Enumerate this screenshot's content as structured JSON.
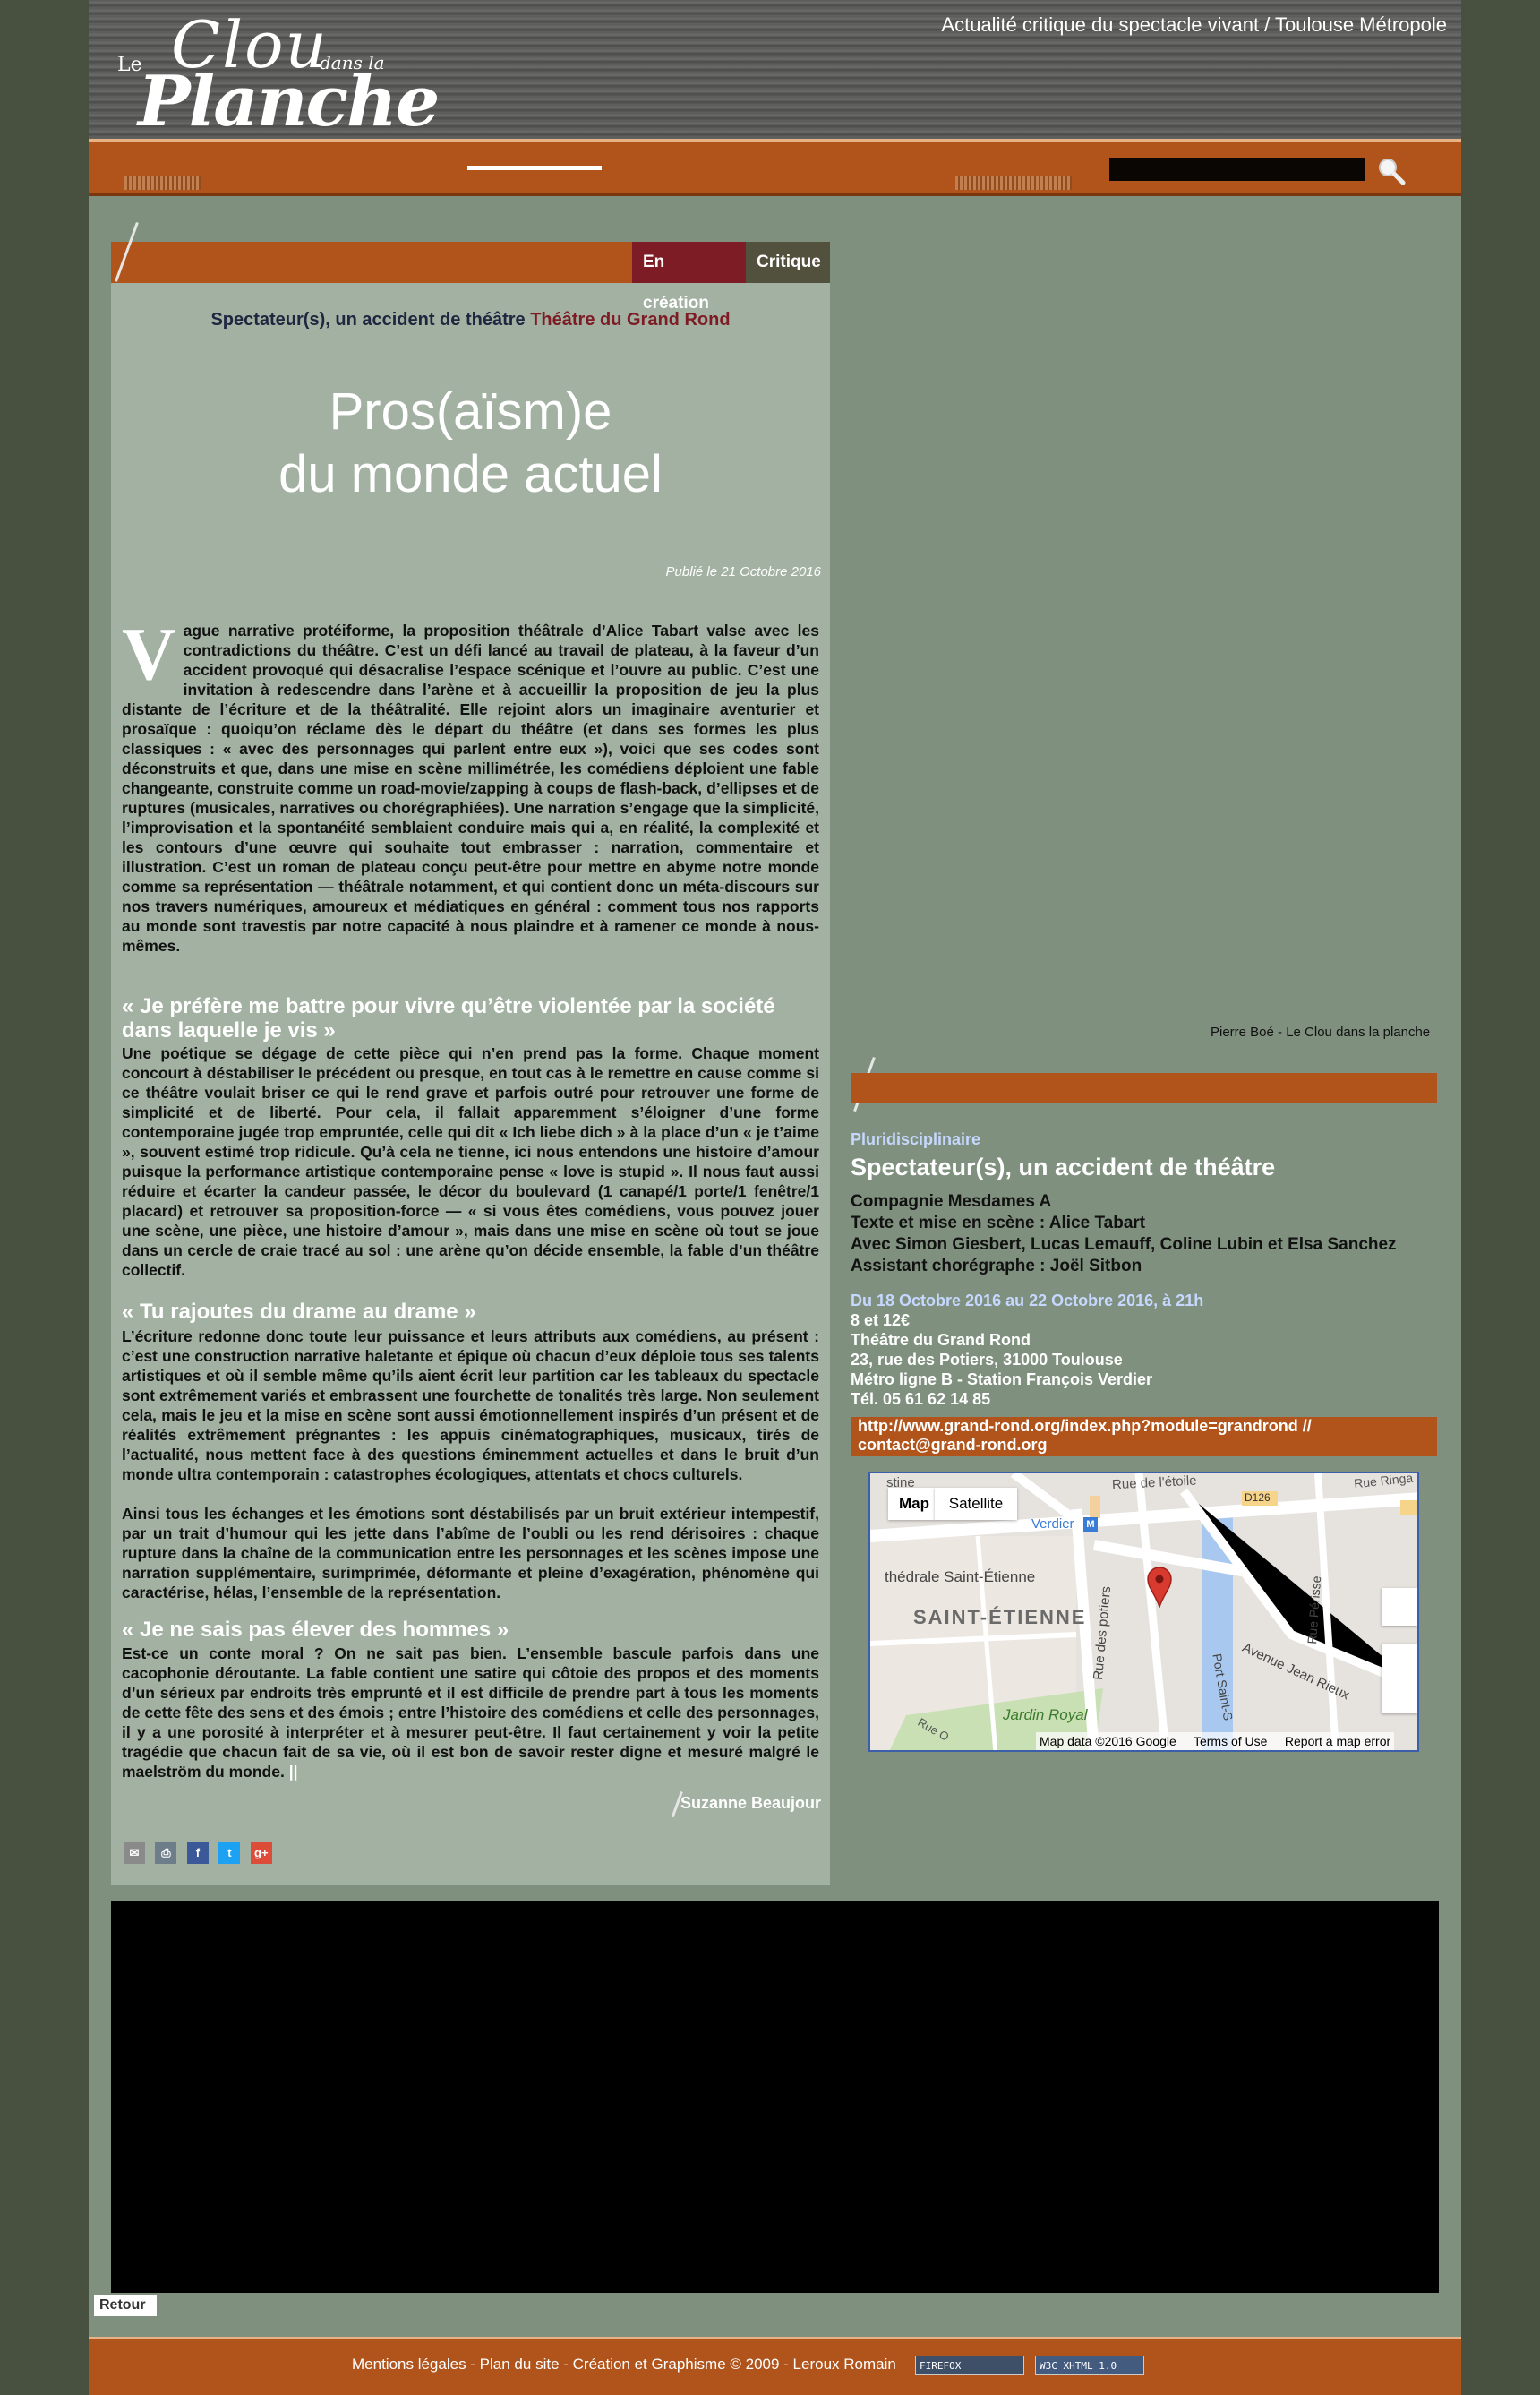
{
  "header": {
    "logo_le": "Le",
    "logo_clou": "Clou",
    "logo_dans_la": "dans la",
    "logo_planche": "Planche",
    "tagline": "Actualité critique du spectacle vivant / Toulouse Métropole"
  },
  "nav": {
    "search_value": ""
  },
  "article": {
    "tabs": [
      "En création",
      "Critique"
    ],
    "show_name": "Spectateur(s), un accident de théâtre",
    "venue": "Théâtre du Grand Rond",
    "title_line1": "Pros(aïsm)e",
    "title_line2": "du monde actuel",
    "published": "Publié le 21 Octobre 2016",
    "dropcap": "V",
    "p1": "ague narrative protéiforme, la proposition théâtrale d’Alice Tabart valse avec les contradictions du théâtre. C’est un défi lancé au travail de plateau, à la faveur d’un accident provoqué qui désacralise l’espace scénique et l’ouvre au public. C’est une invitation à redescendre dans l’arène et à accueillir la proposition de jeu la plus distante de l’écriture et de la théâtralité. Elle rejoint alors un imaginaire aventurier et prosaïque : quoiqu’on réclame dès le départ du théâtre (et dans ses formes les plus classiques : « avec des personnages qui parlent entre eux »), voici que ses codes sont déconstruits et que, dans une mise en scène millimétrée, les comédiens déploient une fable changeante, construite comme un road-movie/zapping à coups de flash-back, d’ellipses et de ruptures (musicales, narratives ou chorégraphiées). Une narration s’engage que la simplicité, l’improvisation et la spontanéité semblaient conduire mais qui a, en réalité, la complexité et les contours d’une œuvre qui souhaite tout embrasser : narration, commentaire et illustration. C’est un roman de plateau conçu peut-être pour mettre en abyme notre monde comme sa représentation — théâtrale notamment, et qui contient donc un méta-discours sur nos travers numériques, amoureux et médiatiques en général : comment tous nos rapports au monde sont travestis par notre capacité à nous plaindre et à ramener ce monde à nous-mêmes.",
    "h2": "« Je préfère me battre pour vivre qu’être violentée par la société dans laquelle je vis »",
    "p2": "Une poétique se dégage de cette pièce qui n’en prend pas la forme. Chaque moment concourt à déstabiliser le précédent ou presque, en tout cas à le remettre en cause comme si ce théâtre voulait briser ce qui le rend grave et parfois outré pour retrouver une forme de simplicité et de liberté. Pour cela, il fallait apparemment s’éloigner d’une forme contemporaine jugée trop empruntée, celle qui dit « Ich liebe dich » à la place d’un « je t’aime », souvent estimé trop ridicule. Qu’à cela ne tienne, ici nous entendons une histoire d’amour puisque la performance artistique contemporaine pense « love is stupid ». Il nous faut aussi réduire et écarter la candeur passée, le décor du boulevard (1 canapé/1 porte/1 fenêtre/1 placard) et retrouver sa proposition-force — « si vous êtes comédiens, vous pouvez jouer une scène, une pièce, une histoire d’amour », mais dans une mise en scène où tout se joue dans un cercle de craie tracé au sol : une arène qu’on décide ensemble, la fable d’un théâtre collectif.",
    "h3": "« Tu rajoutes du drame au drame »",
    "p3a": "L’écriture redonne donc toute leur puissance et leurs attributs aux comédiens, au présent : c’est une construction narrative haletante et épique où chacun d’eux déploie tous ses talents artistiques et où il semble même qu’ils aient écrit leur partition car les tableaux du spectacle sont extrêmement variés et embrassent une fourchette de tonalités très large. Non seulement cela, mais le jeu et la mise en scène sont aussi émotionnellement inspirés d’un présent et de réalités extrêmement prégnantes : les appuis cinématographiques, musicaux, tirés de l’actualité, nous mettent face à des questions éminemment actuelles et dans le bruit d’un monde ultra contemporain : catastrophes écologiques, attentats et chocs culturels.",
    "p3b": "Ainsi tous les échanges et les émotions sont déstabilisés par un bruit extérieur intempestif, par un trait d’humour qui les jette dans l’abîme de l’oubli ou les rend dérisoires : chaque rupture dans la chaîne de la communication entre les personnages et les scènes impose une narration supplémentaire, surimprimée, déformante et pleine d’exagération, phénomène qui caractérise, hélas, l’ensemble de la représentation.",
    "h4": "« Je ne sais pas élever des hommes »",
    "p4": "Est-ce un conte moral ? On ne sait pas bien. L’ensemble bascule parfois dans une cacophonie déroutante. La fable contient une satire qui côtoie des propos et des moments d’un sérieux par endroits très emprunté et il est difficile de prendre part à tous les moments de cette fête des sens et des émois ; entre l’histoire des comédiens et celle des personnages, il y a une porosité à interpréter et à mesurer peut-être. Il faut certainement y voir la petite tragédie que chacun fait de sa vie, où il est bon de savoir rester digne et mesuré malgré le maelström du monde.",
    "end_mark": "||",
    "author": "Suzanne Beaujour",
    "share": [
      "email-icon",
      "print-icon",
      "facebook-icon",
      "twitter-icon",
      "google-plus-icon"
    ]
  },
  "side": {
    "photo_credit": "Pierre Boé - Le Clou dans la planche",
    "category": "Pluridisciplinaire",
    "title": "Spectateur(s), un accident de théâtre",
    "company": "Compagnie Mesdames A",
    "text_direction": "Texte et mise en scène : Alice Tabart",
    "cast": "Avec Simon Giesbert, Lucas Lemauff, Coline Lubin et Elsa Sanchez",
    "choreo": "Assistant chorégraphe : Joël Sitbon",
    "dates": "Du 18 Octobre 2016 au 22 Octobre 2016, à 21h",
    "price": "8 et 12€",
    "venue": "Théâtre du Grand Rond",
    "address": "23, rue des Potiers, 31000 Toulouse",
    "metro": "Métro ligne B - Station François Verdier",
    "tel": "Tél. 05 61 62 14 85",
    "link": "http://www.grand-rond.org/index.php?module=grandrond // contact@grand-rond.org"
  },
  "map": {
    "map_btn": "Map",
    "satellite_btn": "Satellite",
    "labels": {
      "stine": "stine",
      "rue_etoile": "Rue de l'étoile",
      "d126": "D126",
      "rue_ringa": "Rue Ringa",
      "verdier": "Verdier",
      "cathedrale": "thédrale Saint-Étienne",
      "saint_etienne": "SAINT-ÉTIENNE",
      "rue_potiers": "Rue des potiers",
      "rue_perisse": "Rue Périsse",
      "avenue_jean_rieux": "Avenue Jean Rieux",
      "port_saint": "Port Saint-S",
      "jardin_royal": "Jardin Royal",
      "rue_o": "Rue O"
    },
    "footer_data": "Map data ©2016 Google",
    "footer_terms": "Terms of Use",
    "footer_report": "Report a map error",
    "colors": {
      "road": "#ffffff",
      "park": "#c8e0b4",
      "water": "#a8c8f0",
      "pin": "#d93a30"
    }
  },
  "back_label": "Retour",
  "footer": {
    "text": "Mentions légales - Plan du site - Création et Graphisme © 2009 - Leroux Romain",
    "badge1": "FIREFOX",
    "badge2": "W3C XHTML 1.0"
  },
  "colors": {
    "orange": "#b0541b",
    "burgundy": "#7e1c25",
    "panel": "#a2b1a1",
    "page": "#7f907e",
    "outer": "#48503f"
  }
}
